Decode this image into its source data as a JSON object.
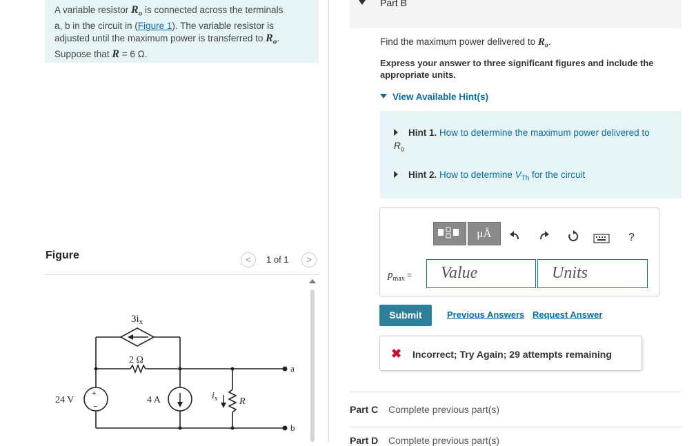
{
  "problem": {
    "line1_pre": "A variable resistor ",
    "ro": "R",
    "ro_sub": "o",
    "line1_post": " is connected across the terminals",
    "line2_pre": "a, b in the circuit in (",
    "figure_link": "Figure 1",
    "line2_post": "). The variable resistor is",
    "line3": "adjusted until the maximum power is transferred to ",
    "line3_end": ".",
    "line4_pre": "Suppose that ",
    "r_var": "R",
    "line4_eq": " = 6 Ω."
  },
  "figure": {
    "title": "Figure",
    "pager": "1 of 1",
    "prev": "<",
    "next": ">",
    "labels": {
      "dep_source": "3i",
      "dep_sub": "x",
      "r2": "2 Ω",
      "v24": "24 V",
      "i4": "4 A",
      "ix": "i",
      "ix_sub": "x",
      "R": "R",
      "a": "a",
      "b": "b",
      "plus": "+",
      "minus": "−"
    }
  },
  "part_b": {
    "label": "Part B",
    "question": "Find the maximum power delivered to ",
    "question_var": "R",
    "question_sub": "o",
    "question_end": ".",
    "instruction": "Express your answer to three significant figures and include the appropriate units.",
    "hints_toggle": "View Available Hint(s)",
    "hint1_num": "Hint 1.",
    "hint1_text": "How to determine the maximum power delivered to",
    "hint1_var": "R",
    "hint1_sub": "o",
    "hint2_num": "Hint 2.",
    "hint2_text_pre": "How to determine ",
    "hint2_var": "V",
    "hint2_sub": "Th",
    "hint2_text_post": " for the circuit",
    "toolbar_units": "μÅ",
    "toolbar_help": "?",
    "pmax_label": "p",
    "pmax_sub": "max",
    "pmax_eq": " =",
    "value_placeholder": "Value",
    "units_placeholder": "Units",
    "submit": "Submit",
    "previous_answers": "Previous Answers",
    "request_answer": "Request Answer",
    "feedback_icon": "✖",
    "feedback": "Incorrect; Try Again; 29 attempts remaining"
  },
  "part_c": {
    "label": "Part C",
    "text": "Complete previous part(s)"
  },
  "part_d": {
    "label": "Part D",
    "text": "Complete previous part(s)"
  },
  "colors": {
    "accent": "#0a6ea8",
    "hint_bg": "#e6f4f5",
    "submit_bg": "#2d7f9a",
    "error": "#c8102e"
  }
}
